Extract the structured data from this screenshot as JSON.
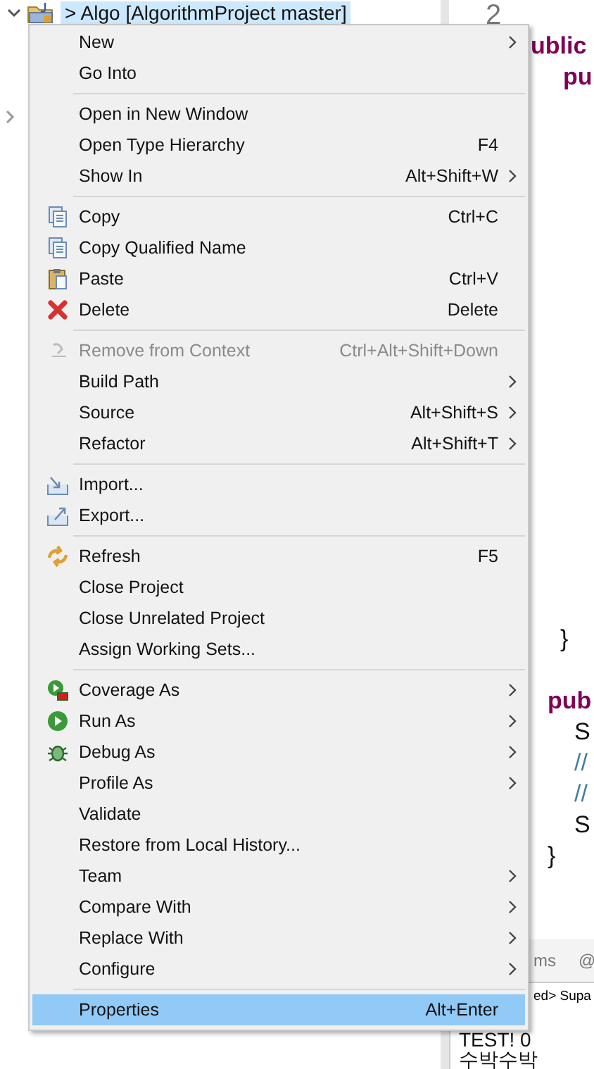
{
  "tree": {
    "root": {
      "label": "> Algo [AlgorithmProject master]",
      "expanded": true,
      "selected": true
    },
    "next_row": {
      "expanded": false
    }
  },
  "editor": {
    "line_number": "2",
    "blocks": [
      [
        {
          "text": "ublic",
          "kind": "keyword"
        },
        {
          "text": "pu",
          "kind": "keyword"
        }
      ],
      [
        {
          "text": "}",
          "kind": "plain"
        }
      ],
      [
        {
          "text": "pub",
          "kind": "keyword"
        },
        {
          "text": "S",
          "kind": "plain"
        },
        {
          "text": "//",
          "kind": "comment"
        },
        {
          "text": "//",
          "kind": "comment"
        },
        {
          "text": "S",
          "kind": "plain"
        },
        {
          "text": "}",
          "kind": "plain"
        }
      ]
    ]
  },
  "console": {
    "tabs": [
      "ms",
      "@"
    ],
    "header": "ed> Supa",
    "lines": [
      "TEST! 0",
      "수박수박"
    ]
  },
  "context_menu": {
    "groups": [
      [
        {
          "label": "New",
          "submenu": true
        },
        {
          "label": "Go Into"
        }
      ],
      [
        {
          "label": "Open in New Window"
        },
        {
          "label": "Open Type Hierarchy",
          "shortcut": "F4"
        },
        {
          "label": "Show In",
          "shortcut": "Alt+Shift+W",
          "submenu": true
        }
      ],
      [
        {
          "label": "Copy",
          "shortcut": "Ctrl+C",
          "kind": "copy"
        },
        {
          "label": "Copy Qualified Name",
          "kind": "copy-name"
        },
        {
          "label": "Paste",
          "shortcut": "Ctrl+V",
          "kind": "paste"
        },
        {
          "label": "Delete",
          "shortcut": "Delete",
          "kind": "delete"
        }
      ],
      [
        {
          "label": "Remove from Context",
          "shortcut": "Ctrl+Alt+Shift+Down",
          "kind": "remove",
          "disabled": true
        },
        {
          "label": "Build Path",
          "submenu": true
        },
        {
          "label": "Source",
          "shortcut": "Alt+Shift+S",
          "submenu": true
        },
        {
          "label": "Refactor",
          "shortcut": "Alt+Shift+T",
          "submenu": true
        }
      ],
      [
        {
          "label": "Import...",
          "kind": "import"
        },
        {
          "label": "Export...",
          "kind": "export"
        }
      ],
      [
        {
          "label": "Refresh",
          "shortcut": "F5",
          "kind": "refresh"
        },
        {
          "label": "Close Project"
        },
        {
          "label": "Close Unrelated Project"
        },
        {
          "label": "Assign Working Sets..."
        }
      ],
      [
        {
          "label": "Coverage As",
          "kind": "coverage",
          "submenu": true
        },
        {
          "label": "Run As",
          "kind": "run",
          "submenu": true
        },
        {
          "label": "Debug As",
          "kind": "debug",
          "submenu": true
        },
        {
          "label": "Profile As",
          "submenu": true
        },
        {
          "label": "Validate"
        },
        {
          "label": "Restore from Local History..."
        },
        {
          "label": "Team",
          "submenu": true
        },
        {
          "label": "Compare With",
          "submenu": true
        },
        {
          "label": "Replace With",
          "submenu": true
        },
        {
          "label": "Configure",
          "submenu": true
        }
      ],
      [
        {
          "label": "Properties",
          "shortcut": "Alt+Enter",
          "selected": true
        }
      ]
    ]
  }
}
